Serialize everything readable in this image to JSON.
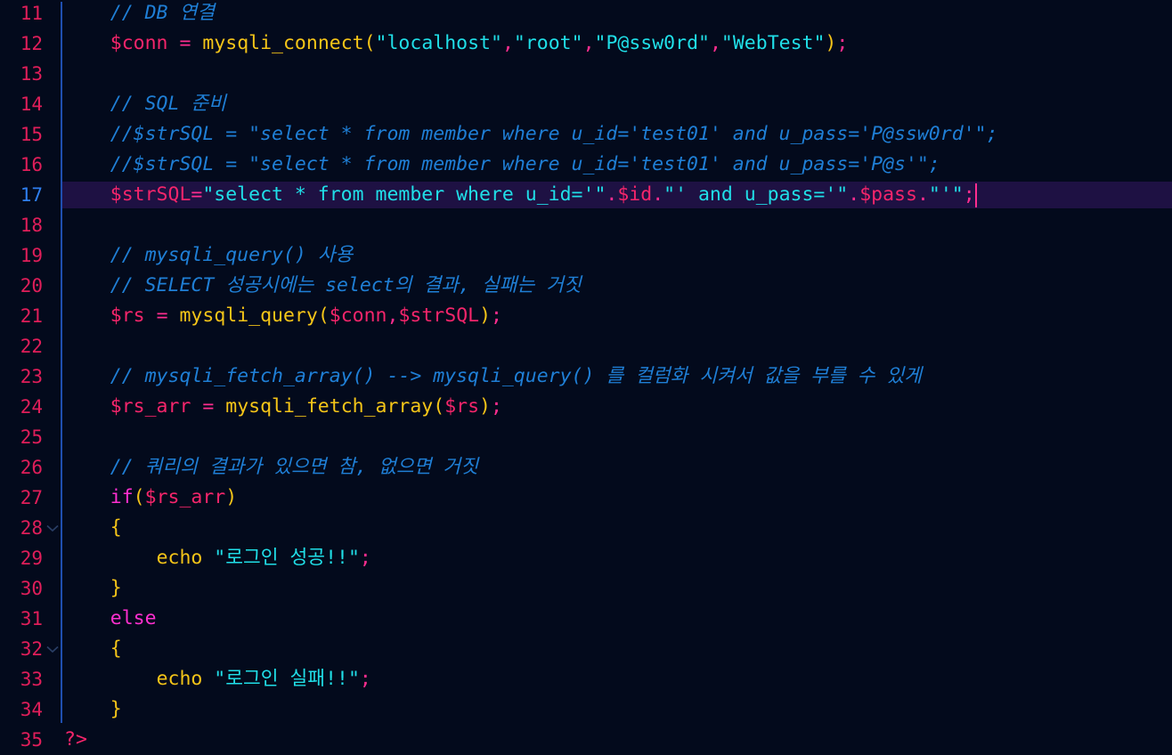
{
  "editor": {
    "language": "PHP",
    "theme": "dark-neon",
    "first_visible_line": 11,
    "last_visible_line": 35,
    "active_line": 17,
    "colors": {
      "background": "#030a1c",
      "active_line_background": "#1e1143",
      "line_number": "#e01e5a",
      "active_line_number": "#2f7ff0",
      "comment": "#1f7fd6",
      "variable": "#f5256b",
      "function": "#f5c518",
      "string": "#20dfe8",
      "keyword": "#ff2fd0",
      "operator": "#ff2d8f",
      "punctuation": "#f5c518",
      "indent_guide": "#1f4fb0",
      "cursor": "#ff2d8f"
    },
    "cursor": {
      "line": 17,
      "column": 75
    }
  },
  "lines": [
    {
      "number": 11,
      "fold": false,
      "active": false,
      "text": "    // DB 연결",
      "tokens": [
        {
          "t": "    ",
          "c": "plain"
        },
        {
          "t": "// DB 연결",
          "c": "cmt"
        }
      ]
    },
    {
      "number": 12,
      "fold": false,
      "active": false,
      "text": "    $conn = mysqli_connect(\"localhost\",\"root\",\"P@ssw0rd\",\"WebTest\");",
      "tokens": [
        {
          "t": "    ",
          "c": "plain"
        },
        {
          "t": "$conn",
          "c": "var"
        },
        {
          "t": " ",
          "c": "plain"
        },
        {
          "t": "=",
          "c": "op"
        },
        {
          "t": " ",
          "c": "plain"
        },
        {
          "t": "mysqli_connect",
          "c": "fn"
        },
        {
          "t": "(",
          "c": "punc"
        },
        {
          "t": "\"localhost\"",
          "c": "str"
        },
        {
          "t": ",",
          "c": "op"
        },
        {
          "t": "\"root\"",
          "c": "str"
        },
        {
          "t": ",",
          "c": "op"
        },
        {
          "t": "\"P@ssw0rd\"",
          "c": "str"
        },
        {
          "t": ",",
          "c": "op"
        },
        {
          "t": "\"WebTest\"",
          "c": "str"
        },
        {
          "t": ")",
          "c": "punc"
        },
        {
          "t": ";",
          "c": "semi"
        }
      ]
    },
    {
      "number": 13,
      "fold": false,
      "active": false,
      "text": "",
      "tokens": []
    },
    {
      "number": 14,
      "fold": false,
      "active": false,
      "text": "    // SQL 준비",
      "tokens": [
        {
          "t": "    ",
          "c": "plain"
        },
        {
          "t": "// SQL 준비",
          "c": "cmt"
        }
      ]
    },
    {
      "number": 15,
      "fold": false,
      "active": false,
      "text": "    //$strSQL = \"select * from member where u_id='test01' and u_pass='P@ssw0rd'\";",
      "tokens": [
        {
          "t": "    ",
          "c": "plain"
        },
        {
          "t": "//$strSQL = \"select * from member where u_id='test01' and u_pass='P@ssw0rd'\";",
          "c": "cmt"
        }
      ]
    },
    {
      "number": 16,
      "fold": false,
      "active": false,
      "text": "    //$strSQL = \"select * from member where u_id='test01' and u_pass='P@s'\";",
      "tokens": [
        {
          "t": "    ",
          "c": "plain"
        },
        {
          "t": "//$strSQL = \"select * from member where u_id='test01' and u_pass='P@s'\";",
          "c": "cmt"
        }
      ]
    },
    {
      "number": 17,
      "fold": false,
      "active": true,
      "text": "    $strSQL=\"select * from member where u_id='\".$id.\"' and u_pass='\".$pass.\"'\";",
      "tokens": [
        {
          "t": "    ",
          "c": "plain"
        },
        {
          "t": "$strSQL",
          "c": "var"
        },
        {
          "t": "=",
          "c": "op"
        },
        {
          "t": "\"select * from member where u_id='\"",
          "c": "str"
        },
        {
          "t": ".",
          "c": "op"
        },
        {
          "t": "$id",
          "c": "var"
        },
        {
          "t": ".",
          "c": "op"
        },
        {
          "t": "\"' and u_pass='\"",
          "c": "str"
        },
        {
          "t": ".",
          "c": "op"
        },
        {
          "t": "$pass",
          "c": "var"
        },
        {
          "t": ".",
          "c": "op"
        },
        {
          "t": "\"'\"",
          "c": "str"
        },
        {
          "t": ";",
          "c": "semi"
        }
      ]
    },
    {
      "number": 18,
      "fold": false,
      "active": false,
      "text": "",
      "tokens": []
    },
    {
      "number": 19,
      "fold": false,
      "active": false,
      "text": "    // mysqli_query() 사용",
      "tokens": [
        {
          "t": "    ",
          "c": "plain"
        },
        {
          "t": "// mysqli_query() 사용",
          "c": "cmt"
        }
      ]
    },
    {
      "number": 20,
      "fold": false,
      "active": false,
      "text": "    // SELECT 성공시에는 select의 결과, 실패는 거짓",
      "tokens": [
        {
          "t": "    ",
          "c": "plain"
        },
        {
          "t": "// SELECT 성공시에는 select의 결과, 실패는 거짓",
          "c": "cmt"
        }
      ]
    },
    {
      "number": 21,
      "fold": false,
      "active": false,
      "text": "    $rs = mysqli_query($conn,$strSQL);",
      "tokens": [
        {
          "t": "    ",
          "c": "plain"
        },
        {
          "t": "$rs",
          "c": "var"
        },
        {
          "t": " ",
          "c": "plain"
        },
        {
          "t": "=",
          "c": "op"
        },
        {
          "t": " ",
          "c": "plain"
        },
        {
          "t": "mysqli_query",
          "c": "fn"
        },
        {
          "t": "(",
          "c": "punc"
        },
        {
          "t": "$conn",
          "c": "var"
        },
        {
          "t": ",",
          "c": "op"
        },
        {
          "t": "$strSQL",
          "c": "var"
        },
        {
          "t": ")",
          "c": "punc"
        },
        {
          "t": ";",
          "c": "semi"
        }
      ]
    },
    {
      "number": 22,
      "fold": false,
      "active": false,
      "text": "",
      "tokens": []
    },
    {
      "number": 23,
      "fold": false,
      "active": false,
      "text": "    // mysqli_fetch_array() --> mysqli_query() 를 컬럼화 시켜서 값을 부를 수 있게",
      "tokens": [
        {
          "t": "    ",
          "c": "plain"
        },
        {
          "t": "// mysqli_fetch_array() --> mysqli_query() 를 컬럼화 시켜서 값을 부를 수 있게",
          "c": "cmt"
        }
      ]
    },
    {
      "number": 24,
      "fold": false,
      "active": false,
      "text": "    $rs_arr = mysqli_fetch_array($rs);",
      "tokens": [
        {
          "t": "    ",
          "c": "plain"
        },
        {
          "t": "$rs_arr",
          "c": "var"
        },
        {
          "t": " ",
          "c": "plain"
        },
        {
          "t": "=",
          "c": "op"
        },
        {
          "t": " ",
          "c": "plain"
        },
        {
          "t": "mysqli_fetch_array",
          "c": "fn"
        },
        {
          "t": "(",
          "c": "punc"
        },
        {
          "t": "$rs",
          "c": "var"
        },
        {
          "t": ")",
          "c": "punc"
        },
        {
          "t": ";",
          "c": "semi"
        }
      ]
    },
    {
      "number": 25,
      "fold": false,
      "active": false,
      "text": "",
      "tokens": []
    },
    {
      "number": 26,
      "fold": false,
      "active": false,
      "text": "    // 쿼리의 결과가 있으면 참, 없으면 거짓",
      "tokens": [
        {
          "t": "    ",
          "c": "plain"
        },
        {
          "t": "// 쿼리의 결과가 있으면 참, 없으면 거짓",
          "c": "cmt"
        }
      ]
    },
    {
      "number": 27,
      "fold": false,
      "active": false,
      "text": "    if($rs_arr)",
      "tokens": [
        {
          "t": "    ",
          "c": "plain"
        },
        {
          "t": "if",
          "c": "kw"
        },
        {
          "t": "(",
          "c": "punc"
        },
        {
          "t": "$rs_arr",
          "c": "var"
        },
        {
          "t": ")",
          "c": "punc"
        }
      ]
    },
    {
      "number": 28,
      "fold": true,
      "active": false,
      "text": "    {",
      "tokens": [
        {
          "t": "    ",
          "c": "plain"
        },
        {
          "t": "{",
          "c": "punc"
        }
      ]
    },
    {
      "number": 29,
      "fold": false,
      "active": false,
      "text": "        echo \"로그인 성공!!\";",
      "tokens": [
        {
          "t": "        ",
          "c": "plain"
        },
        {
          "t": "echo",
          "c": "fn"
        },
        {
          "t": " ",
          "c": "plain"
        },
        {
          "t": "\"로그인 성공!!\"",
          "c": "str"
        },
        {
          "t": ";",
          "c": "semi"
        }
      ]
    },
    {
      "number": 30,
      "fold": false,
      "active": false,
      "text": "    }",
      "tokens": [
        {
          "t": "    ",
          "c": "plain"
        },
        {
          "t": "}",
          "c": "punc"
        }
      ]
    },
    {
      "number": 31,
      "fold": false,
      "active": false,
      "text": "    else",
      "tokens": [
        {
          "t": "    ",
          "c": "plain"
        },
        {
          "t": "else",
          "c": "kw"
        }
      ]
    },
    {
      "number": 32,
      "fold": true,
      "active": false,
      "text": "    {",
      "tokens": [
        {
          "t": "    ",
          "c": "plain"
        },
        {
          "t": "{",
          "c": "punc"
        }
      ]
    },
    {
      "number": 33,
      "fold": false,
      "active": false,
      "text": "        echo \"로그인 실패!!\";",
      "tokens": [
        {
          "t": "        ",
          "c": "plain"
        },
        {
          "t": "echo",
          "c": "fn"
        },
        {
          "t": " ",
          "c": "plain"
        },
        {
          "t": "\"로그인 실패!!\"",
          "c": "str"
        },
        {
          "t": ";",
          "c": "semi"
        }
      ]
    },
    {
      "number": 34,
      "fold": false,
      "active": false,
      "text": "    }",
      "tokens": [
        {
          "t": "    ",
          "c": "plain"
        },
        {
          "t": "}",
          "c": "punc"
        }
      ]
    },
    {
      "number": 35,
      "fold": false,
      "active": false,
      "text": "?>",
      "tokens": [
        {
          "t": "?>",
          "c": "tag"
        }
      ]
    }
  ]
}
